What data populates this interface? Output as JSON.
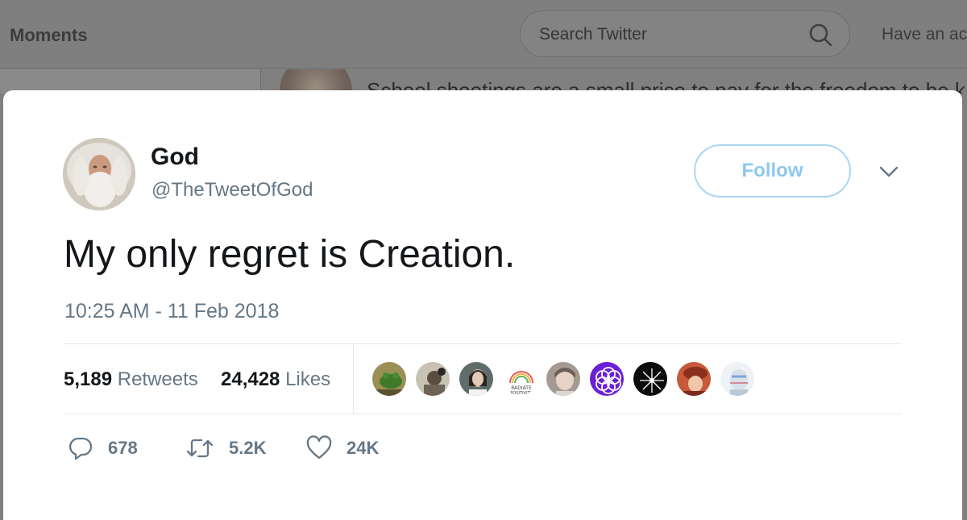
{
  "topbar": {
    "moments_label": "Moments",
    "search_placeholder": "Search Twitter",
    "signup_prompt": "Have an ac"
  },
  "background_tweet": {
    "text": "School shootings are a small price to pay for the freedom to be k"
  },
  "tweet": {
    "author_name": "God",
    "author_handle": "@TheTweetOfGod",
    "follow_label": "Follow",
    "text": "My only regret is Creation.",
    "timestamp": "10:25 AM - 11 Feb 2018",
    "retweets_count": "5,189",
    "retweets_label": "Retweets",
    "likes_count": "24,428",
    "likes_label": "Likes",
    "likers": [
      "frog",
      "traveler",
      "selfie",
      "radiate-positivity",
      "portrait",
      "purple-flower",
      "sparkler",
      "hat",
      "glitch"
    ],
    "likers_badge_text": "RADIATE POSITIVITY",
    "actions": {
      "reply_count": "678",
      "retweet_count": "5.2K",
      "like_count": "24K"
    }
  },
  "colors": {
    "accent": "#1da1f2",
    "follow_border": "#a8d6f5",
    "muted_text": "#657786",
    "overlay": "#7f7f7f"
  }
}
